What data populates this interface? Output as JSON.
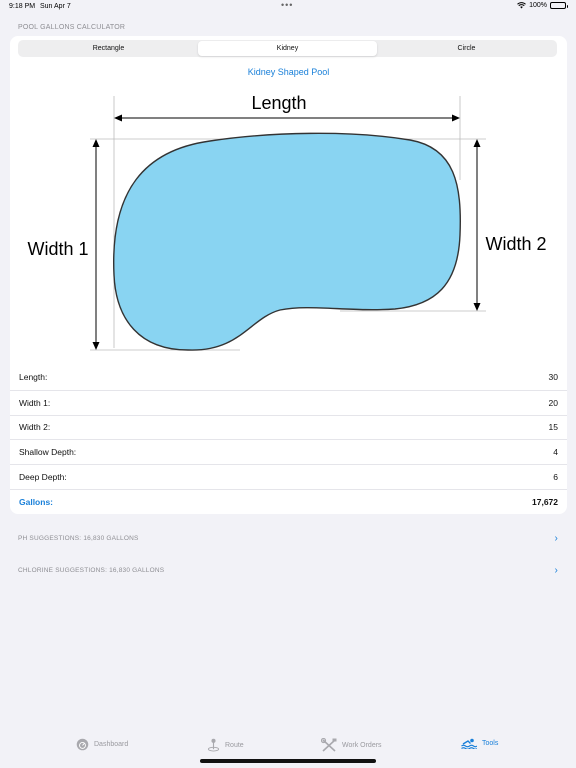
{
  "status_bar": {
    "time": "9:18 PM",
    "date": "Sun Apr 7",
    "battery": "100%"
  },
  "header": {
    "section_title": "POOL GALLONS CALCULATOR"
  },
  "segments": [
    {
      "label": "Rectangle",
      "selected": false
    },
    {
      "label": "Kidney",
      "selected": true
    },
    {
      "label": "Circle",
      "selected": false
    }
  ],
  "pool": {
    "title": "Kidney Shaped Pool",
    "fill_color": "#89d4f2",
    "diagram_labels": {
      "length": "Length",
      "width1": "Width 1",
      "width2": "Width 2"
    }
  },
  "fields": [
    {
      "label": "Length:",
      "value": "30"
    },
    {
      "label": "Width 1:",
      "value": "20"
    },
    {
      "label": "Width 2:",
      "value": "15"
    },
    {
      "label": "Shallow Depth:",
      "value": "4"
    },
    {
      "label": "Deep Depth:",
      "value": "6"
    }
  ],
  "result": {
    "label": "Gallons:",
    "value": "17,672"
  },
  "suggestions": [
    {
      "label": "PH SUGGESTIONS: 16,830 GALLONS"
    },
    {
      "label": "CHLORINE SUGGESTIONS: 16,830 GALLONS"
    }
  ],
  "tabs": [
    {
      "label": "Dashboard",
      "icon": "dashboard-icon",
      "active": false
    },
    {
      "label": "Route",
      "icon": "route-icon",
      "active": false
    },
    {
      "label": "Work Orders",
      "icon": "tools-icon",
      "active": false
    },
    {
      "label": "Tools",
      "icon": "swimmer-icon",
      "active": true
    }
  ],
  "colors": {
    "accent": "#1a80d9",
    "background": "#f2f2f7"
  }
}
